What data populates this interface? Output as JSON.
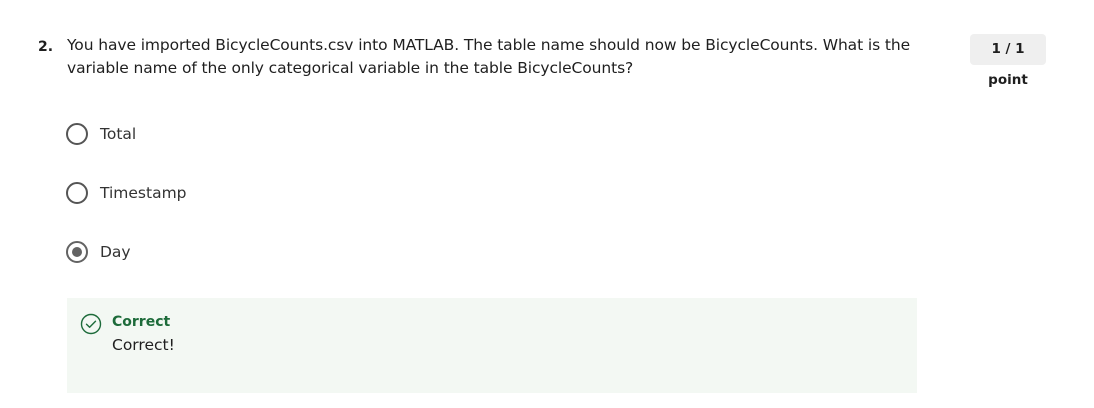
{
  "question": {
    "number": "2.",
    "text": "You have imported BicycleCounts.csv into MATLAB. The table name should now be BicycleCounts. What is the variable name of the only categorical variable in the table BicycleCounts?",
    "points": "1 / 1 point"
  },
  "options": [
    {
      "label": "Total",
      "selected": false
    },
    {
      "label": "Timestamp",
      "selected": false
    },
    {
      "label": "Day",
      "selected": true
    }
  ],
  "feedback": {
    "icon": "check-circle-icon",
    "status": "Correct",
    "message": "Correct!",
    "status_color": "#1d6b3a",
    "background_color": "#f3f8f3"
  }
}
